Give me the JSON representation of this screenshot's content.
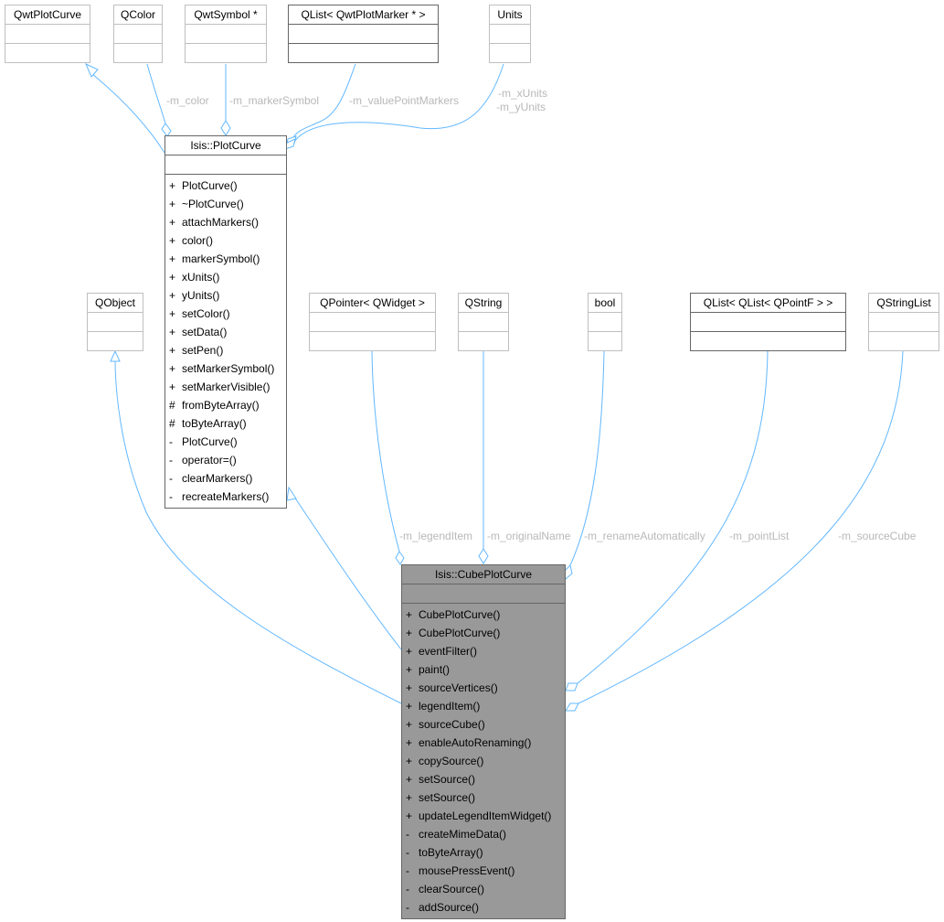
{
  "colors": {
    "edge": "#63b8ff",
    "edge_label": "#b8b8b8",
    "focus_fill": "#999999"
  },
  "classes": {
    "qwtplotcurve": {
      "name": "QwtPlotCurve"
    },
    "qcolor": {
      "name": "QColor"
    },
    "qwtsymbol": {
      "name": "QwtSymbol *"
    },
    "qlist_markers": {
      "name": "QList< QwtPlotMarker * >"
    },
    "units": {
      "name": "Units"
    },
    "qobject": {
      "name": "QObject"
    },
    "qpointer": {
      "name": "QPointer< QWidget >"
    },
    "qstring": {
      "name": "QString"
    },
    "bool": {
      "name": "bool"
    },
    "qlist_points": {
      "name": "QList< QList< QPointF > >"
    },
    "qstringlist": {
      "name": "QStringList"
    },
    "plotcurve": {
      "name": "Isis::PlotCurve",
      "ops": [
        {
          "vis": "+",
          "name": "PlotCurve()"
        },
        {
          "vis": "+",
          "name": "~PlotCurve()"
        },
        {
          "vis": "+",
          "name": "attachMarkers()"
        },
        {
          "vis": "+",
          "name": "color()"
        },
        {
          "vis": "+",
          "name": "markerSymbol()"
        },
        {
          "vis": "+",
          "name": "xUnits()"
        },
        {
          "vis": "+",
          "name": "yUnits()"
        },
        {
          "vis": "+",
          "name": "setColor()"
        },
        {
          "vis": "+",
          "name": "setData()"
        },
        {
          "vis": "+",
          "name": "setPen()"
        },
        {
          "vis": "+",
          "name": "setMarkerSymbol()"
        },
        {
          "vis": "+",
          "name": "setMarkerVisible()"
        },
        {
          "vis": "#",
          "name": "fromByteArray()"
        },
        {
          "vis": "#",
          "name": "toByteArray()"
        },
        {
          "vis": "-",
          "name": "PlotCurve()"
        },
        {
          "vis": "-",
          "name": "operator=()"
        },
        {
          "vis": "-",
          "name": "clearMarkers()"
        },
        {
          "vis": "-",
          "name": "recreateMarkers()"
        }
      ]
    },
    "cubeplotcurve": {
      "name": "Isis::CubePlotCurve",
      "ops": [
        {
          "vis": "+",
          "name": "CubePlotCurve()"
        },
        {
          "vis": "+",
          "name": "CubePlotCurve()"
        },
        {
          "vis": "+",
          "name": "eventFilter()"
        },
        {
          "vis": "+",
          "name": "paint()"
        },
        {
          "vis": "+",
          "name": "sourceVertices()"
        },
        {
          "vis": "+",
          "name": "legendItem()"
        },
        {
          "vis": "+",
          "name": "sourceCube()"
        },
        {
          "vis": "+",
          "name": "enableAutoRenaming()"
        },
        {
          "vis": "+",
          "name": "copySource()"
        },
        {
          "vis": "+",
          "name": "setSource()"
        },
        {
          "vis": "+",
          "name": "setSource()"
        },
        {
          "vis": "+",
          "name": "updateLegendItemWidget()"
        },
        {
          "vis": "-",
          "name": "createMimeData()"
        },
        {
          "vis": "-",
          "name": "toByteArray()"
        },
        {
          "vis": "-",
          "name": "mousePressEvent()"
        },
        {
          "vis": "-",
          "name": "clearSource()"
        },
        {
          "vis": "-",
          "name": "addSource()"
        }
      ]
    }
  },
  "edge_labels": {
    "m_color": "-m_color",
    "m_markerSymbol": "-m_markerSymbol",
    "m_valuePointMarkers": "-m_valuePointMarkers",
    "m_xUnits": "-m_xUnits",
    "m_yUnits": "-m_yUnits",
    "m_legendItem": "-m_legendItem",
    "m_originalName": "-m_originalName",
    "m_renameAutomatically": "-m_renameAutomatically",
    "m_pointList": "-m_pointList",
    "m_sourceCube": "-m_sourceCube"
  }
}
